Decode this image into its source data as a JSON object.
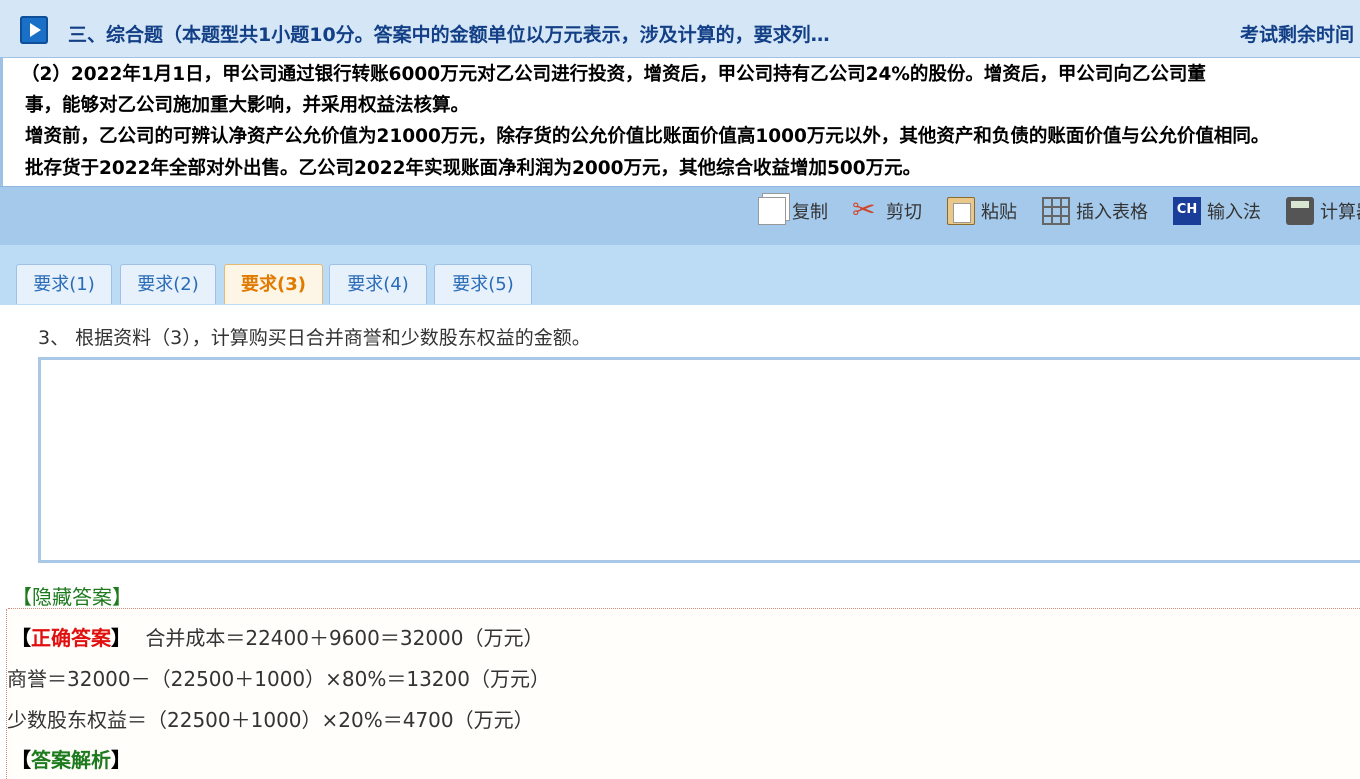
{
  "header": {
    "title": "三、综合题（本题型共1小题10分。答案中的金额单位以万元表示，涉及计算的，要求列…",
    "timer_label": "考试剩余时间"
  },
  "material": {
    "lines": [
      "（2）2022年1月1日，甲公司通过银行转账6000万元对乙公司进行投资，增资后，甲公司持有乙公司24%的股份。增资后，甲公司向乙公司董",
      "事，能够对乙公司施加重大影响，并采用权益法核算。",
      "增资前，乙公司的可辨认净资产公允价值为21000万元，除存货的公允价值比账面价值高1000万元以外，其他资产和负债的账面价值与公允价值相同。",
      "批存货于2022年全部对外出售。乙公司2022年实现账面净利润为2000万元，其他综合收益增加500万元。"
    ]
  },
  "toolbar": {
    "copy": "复制",
    "cut": "剪切",
    "paste": "粘贴",
    "insert_table": "插入表格",
    "ime": "输入法",
    "ime_icon_text": "CH",
    "calculator": "计算器"
  },
  "tabs": [
    "要求(1)",
    "要求(2)",
    "要求(3)",
    "要求(4)",
    "要求(5)"
  ],
  "active_tab": 2,
  "question": "3、 根据资料（3），计算购买日合并商誉和少数股东权益的金额。",
  "answer_input": {
    "value": ""
  },
  "toggle_link": "【隐藏答案】",
  "answer": {
    "correct_label": "正确答案",
    "bracket_open": "【",
    "bracket_close": "】",
    "line1": "合并成本＝22400＋9600＝32000（万元）",
    "line2": "商誉＝32000－（22500＋1000）×80%＝13200（万元）",
    "line3": "少数股东权益＝（22500＋1000）×20%＝4700（万元）",
    "analysis_label": "答案解析"
  }
}
